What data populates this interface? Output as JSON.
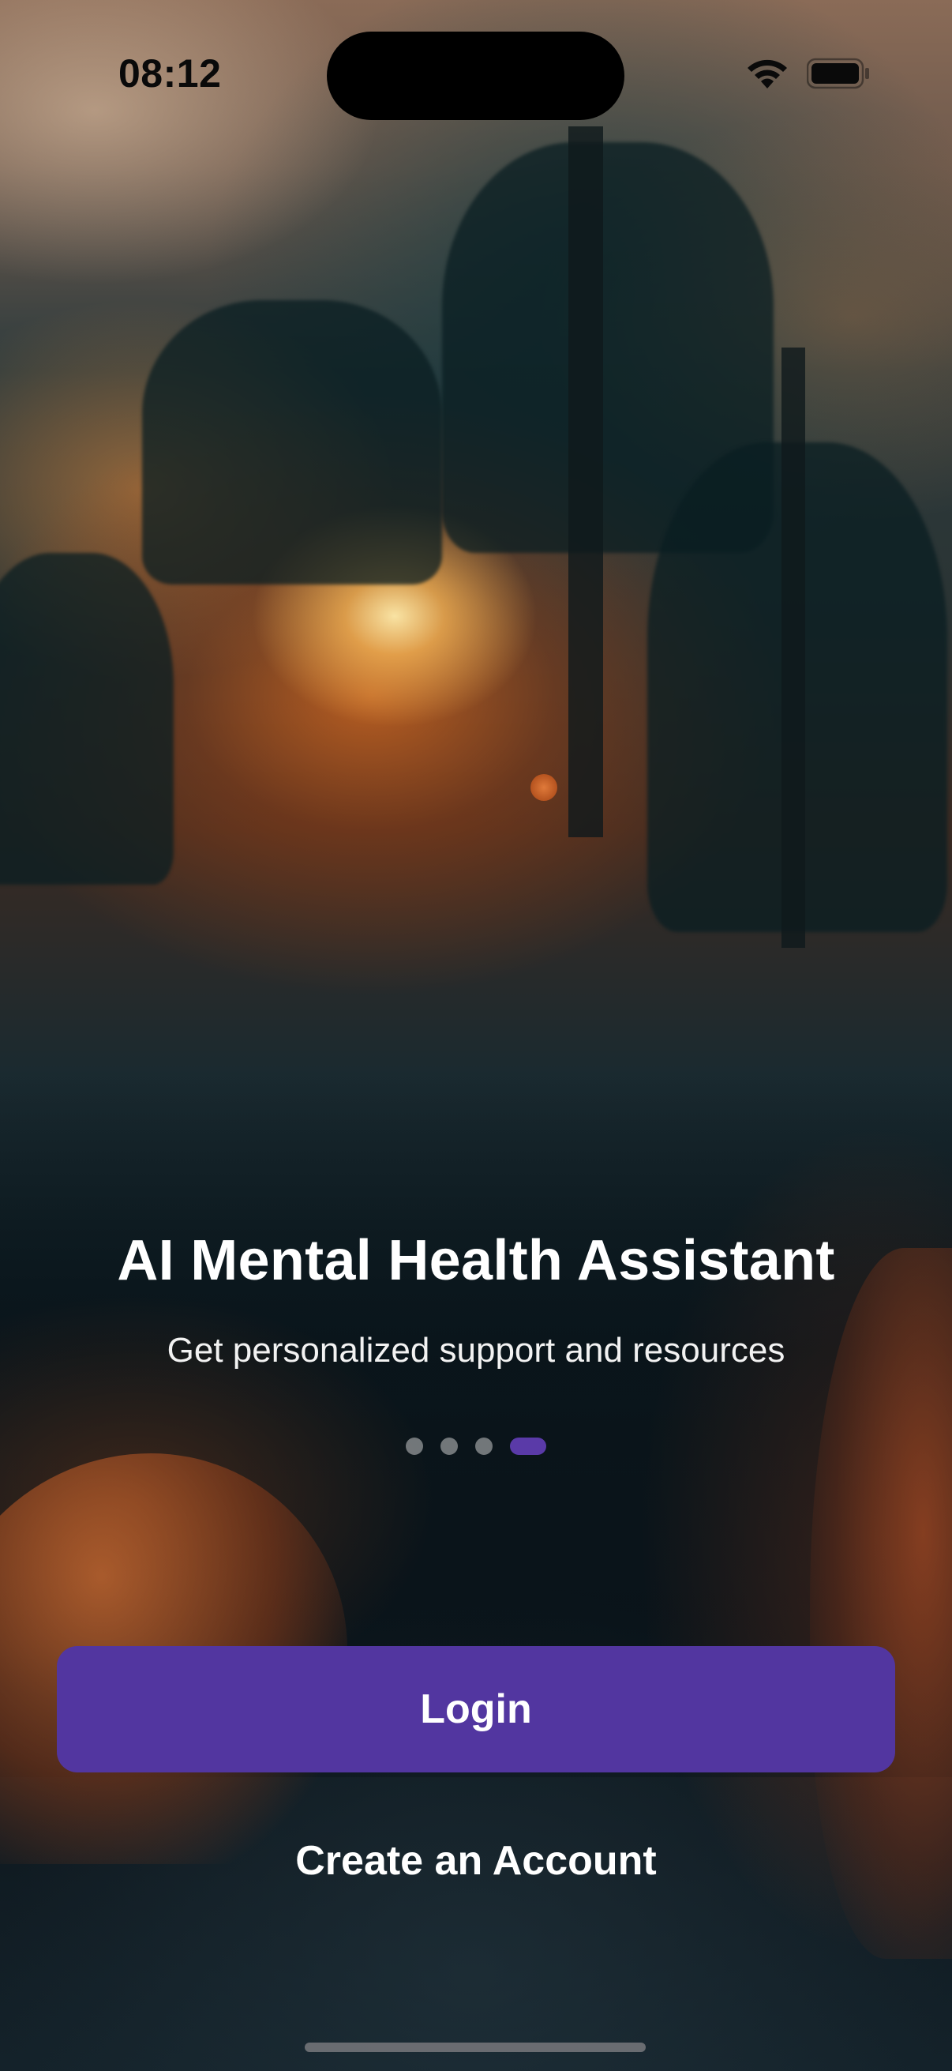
{
  "status_bar": {
    "time": "08:12",
    "wifi_icon": "wifi-icon",
    "battery_icon": "battery-icon"
  },
  "onboarding": {
    "title": "AI Mental Health Assistant",
    "subtitle": "Get personalized support and resources",
    "page_indicator": {
      "total_pages": 4,
      "current_page": 4
    }
  },
  "actions": {
    "login_label": "Login",
    "create_account_label": "Create an Account"
  },
  "colors": {
    "primary": "#5236a0",
    "active_dot": "#5a3aa8"
  }
}
